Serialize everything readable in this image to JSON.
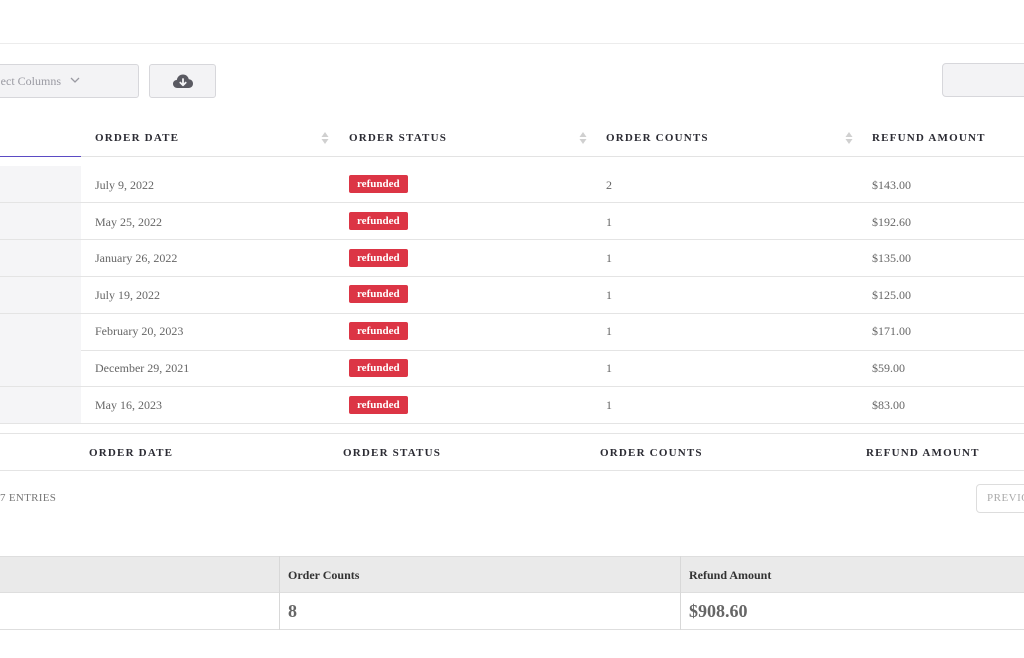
{
  "toolbar": {
    "select_columns_text": "Select Columns",
    "download_icon": "cloud-download-icon",
    "chevron_icon": "chevron-down-icon"
  },
  "table": {
    "headers": [
      "ORDER DATE",
      "ORDER STATUS",
      "ORDER COUNTS",
      "REFUND AMOUNT"
    ],
    "rows": [
      {
        "date": "July 9, 2022",
        "status": "refunded",
        "count": "2",
        "amount": "$143.00"
      },
      {
        "date": "May 25, 2022",
        "status": "refunded",
        "count": "1",
        "amount": "$192.60"
      },
      {
        "date": "January 26, 2022",
        "status": "refunded",
        "count": "1",
        "amount": "$135.00"
      },
      {
        "date": "July 19, 2022",
        "status": "refunded",
        "count": "1",
        "amount": "$125.00"
      },
      {
        "date": "February 20, 2023",
        "status": "refunded",
        "count": "1",
        "amount": "$171.00"
      },
      {
        "date": "December 29, 2021",
        "status": "refunded",
        "count": "1",
        "amount": "$59.00"
      },
      {
        "date": "May 16, 2023",
        "status": "refunded",
        "count": "1",
        "amount": "$83.00"
      }
    ],
    "footers": [
      "ORDER DATE",
      "ORDER STATUS",
      "ORDER COUNTS",
      "REFUND AMOUNT"
    ]
  },
  "pagination": {
    "entries_info": "7 ENTRIES",
    "previous_label": "PREVIOUS"
  },
  "summary": {
    "order_counts_label": "Order Counts",
    "order_counts_value": "8",
    "refund_amount_label": "Refund Amount",
    "refund_amount_value": "$908.60"
  },
  "colors": {
    "badge_refunded": "#dc3545",
    "active_underline": "#5b4bc4"
  }
}
